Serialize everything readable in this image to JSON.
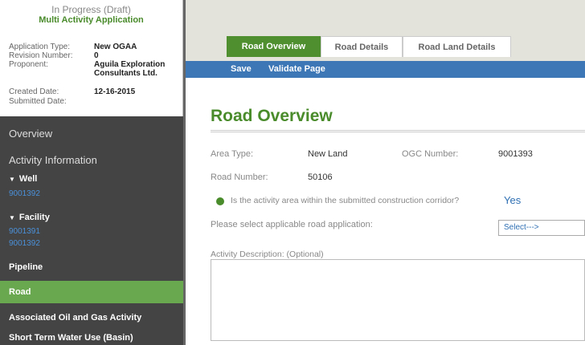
{
  "app_card": {
    "status": "In Progress (Draft)",
    "title": "Multi Activity Application",
    "rows": [
      {
        "label": "Application Type:",
        "value": "New OGAA"
      },
      {
        "label": "Revision Number:",
        "value": "0"
      },
      {
        "label": "Proponent:",
        "value": "Aguila Exploration Consultants Ltd."
      },
      {
        "label": "Created Date:",
        "value": "12-16-2015"
      },
      {
        "label": "Submitted Date:",
        "value": ""
      }
    ]
  },
  "sidebar": {
    "overview": "Overview",
    "activity_information": "Activity Information",
    "well": {
      "label": "Well",
      "links": [
        "9001392"
      ]
    },
    "facility": {
      "label": "Facility",
      "links": [
        "9001391",
        "9001392"
      ]
    },
    "pipeline": "Pipeline",
    "road": "Road",
    "associated": "Associated Oil and Gas Activity",
    "short_term_water": "Short Term Water Use (Basin)"
  },
  "tabs": [
    "Road Overview",
    "Road Details",
    "Road Land Details"
  ],
  "active_tab": "Road Overview",
  "toolbar": {
    "save": "Save",
    "validate": "Validate Page"
  },
  "page_title": "Road Overview",
  "fields": {
    "area_type_label": "Area Type:",
    "area_type_value": "New Land",
    "ogc_number_label": "OGC Number:",
    "ogc_number_value": "9001393",
    "road_number_label": "Road Number:",
    "road_number_value": "50106",
    "corridor_question": "Is the activity area within the submitted construction corridor?",
    "corridor_answer": "Yes",
    "road_application_label": "Please select applicable road application:",
    "road_application_select": "Select--->",
    "activity_description_label": "Activity Description: (Optional)",
    "activity_description_value": ""
  },
  "colors": {
    "accent_green": "#4f8f2f",
    "toolbar_blue": "#3d77b6",
    "link_blue": "#4a90d9"
  }
}
